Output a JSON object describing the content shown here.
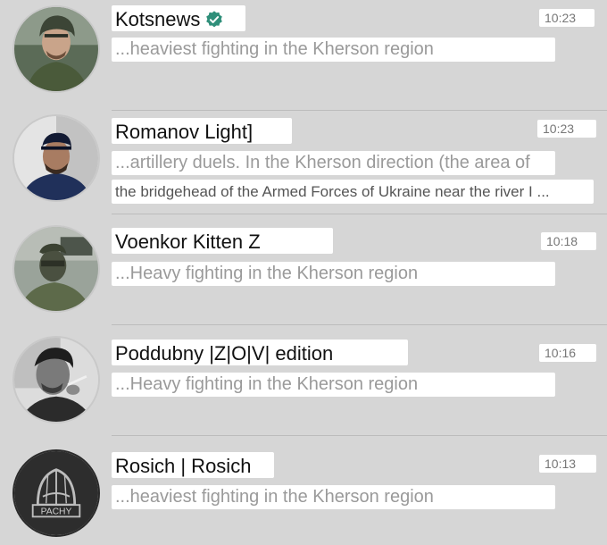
{
  "chats": [
    {
      "name": "Kotsnews",
      "verified": true,
      "time": "10:23",
      "lines": [
        "...heaviest fighting in the Kherson region"
      ],
      "avatar_icon": "soldier-helmet-avatar"
    },
    {
      "name": "Romanov Light]",
      "verified": false,
      "time": "10:23",
      "lines": [
        "...artillery duels. In the Kherson direction (the area of",
        "the bridgehead of the Armed Forces of Ukraine near the river I ..."
      ],
      "avatar_icon": "man-cap-avatar"
    },
    {
      "name": "Voenkor Kitten Z",
      "verified": false,
      "time": "10:18",
      "lines": [
        "...Heavy fighting in the Kherson region"
      ],
      "avatar_icon": "masked-soldier-avatar"
    },
    {
      "name": "Poddubny |Z|O|V| edition",
      "verified": false,
      "time": "10:16",
      "lines": [
        "...Heavy fighting in the Kherson region"
      ],
      "avatar_icon": "smoking-man-avatar"
    },
    {
      "name": "Rosich | Rosich",
      "verified": false,
      "time": "10:13",
      "lines": [
        "...heaviest fighting in the Kherson region"
      ],
      "avatar_icon": "pachy-helmet-logo-avatar",
      "logo_text": "PACHY"
    }
  ],
  "colors": {
    "background": "#d6d6d6",
    "verified": "#2f8f7a",
    "preview_text": "#9a9a9a"
  }
}
